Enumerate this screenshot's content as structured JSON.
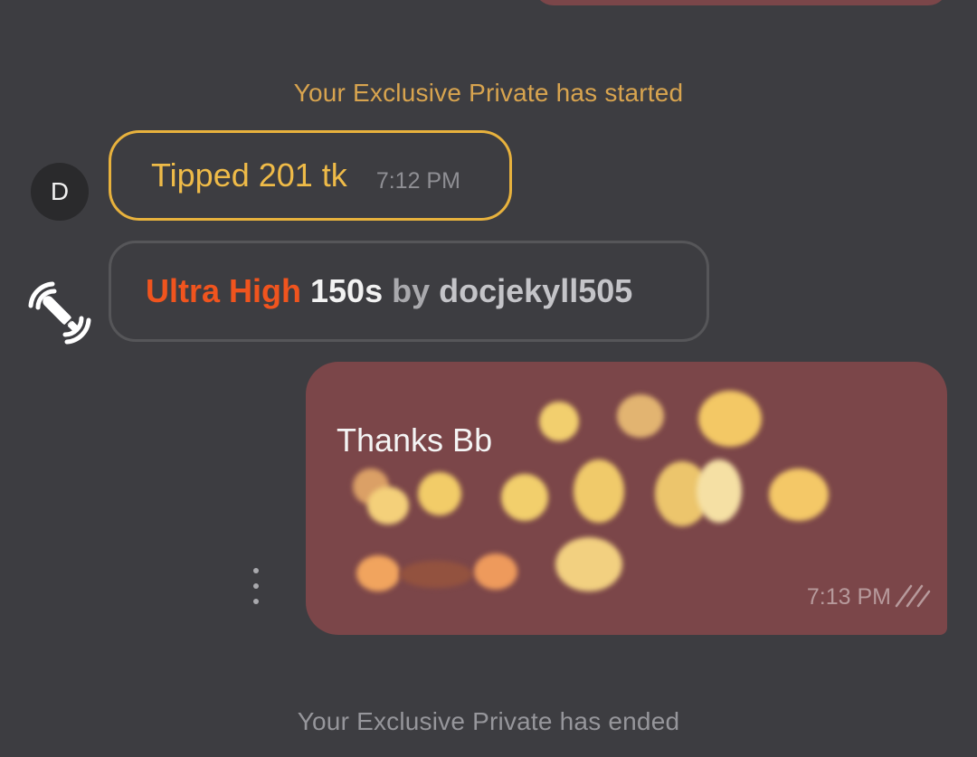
{
  "chat": {
    "system_start": "Your Exclusive Private has started",
    "system_end": "Your Exclusive Private has ended",
    "tip_message": {
      "avatar_initial": "D",
      "text": "Tipped 201 tk",
      "time": "7:12 PM"
    },
    "toy_message": {
      "level": "Ultra High",
      "duration": "150s",
      "by_label": "by",
      "username": "docjekyll505"
    },
    "outgoing_message": {
      "text": "Thanks Bb",
      "time": "7:13 PM",
      "status_icon": "double-check-icon"
    },
    "more_menu_icon": "more-vertical-icon"
  },
  "colors": {
    "background": "#3d3d41",
    "outgoing_bubble": "#7b4649",
    "tip_accent": "#e8b23d",
    "ultra_high": "#f0541e",
    "muted_text": "#96969b"
  }
}
